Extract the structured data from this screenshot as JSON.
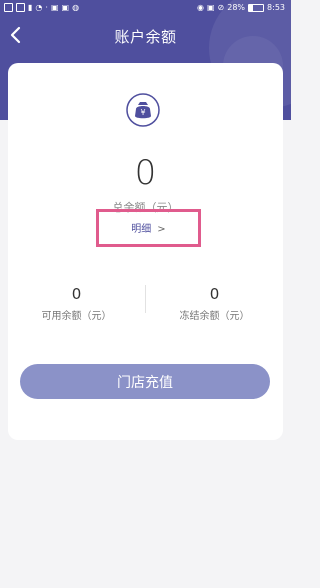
{
  "status_bar": {
    "left_icons": [
      "sim-icon",
      "hd-icon",
      "signal-icon",
      "wifi-icon",
      "speed-icon",
      "app-icon",
      "app-icon",
      "app-icon"
    ],
    "battery_text": "28%",
    "time": "8:53"
  },
  "nav": {
    "title": "账户余额",
    "back_icon": "chevron-left-icon"
  },
  "balance": {
    "icon": "money-bag-icon",
    "value": "0",
    "label": "总余额（元）",
    "detail_label": "明细",
    "detail_chevron": ">"
  },
  "sub_balances": [
    {
      "value": "0",
      "label": "可用余额（元）"
    },
    {
      "value": "0",
      "label": "冻结余额（元）"
    }
  ],
  "action": {
    "recharge_label": "门店充值"
  },
  "colors": {
    "header_bg": "#4f4f9e",
    "accent": "#4f4f9e",
    "button_bg": "#8b92c8",
    "highlight_box": "#e05b8d"
  }
}
